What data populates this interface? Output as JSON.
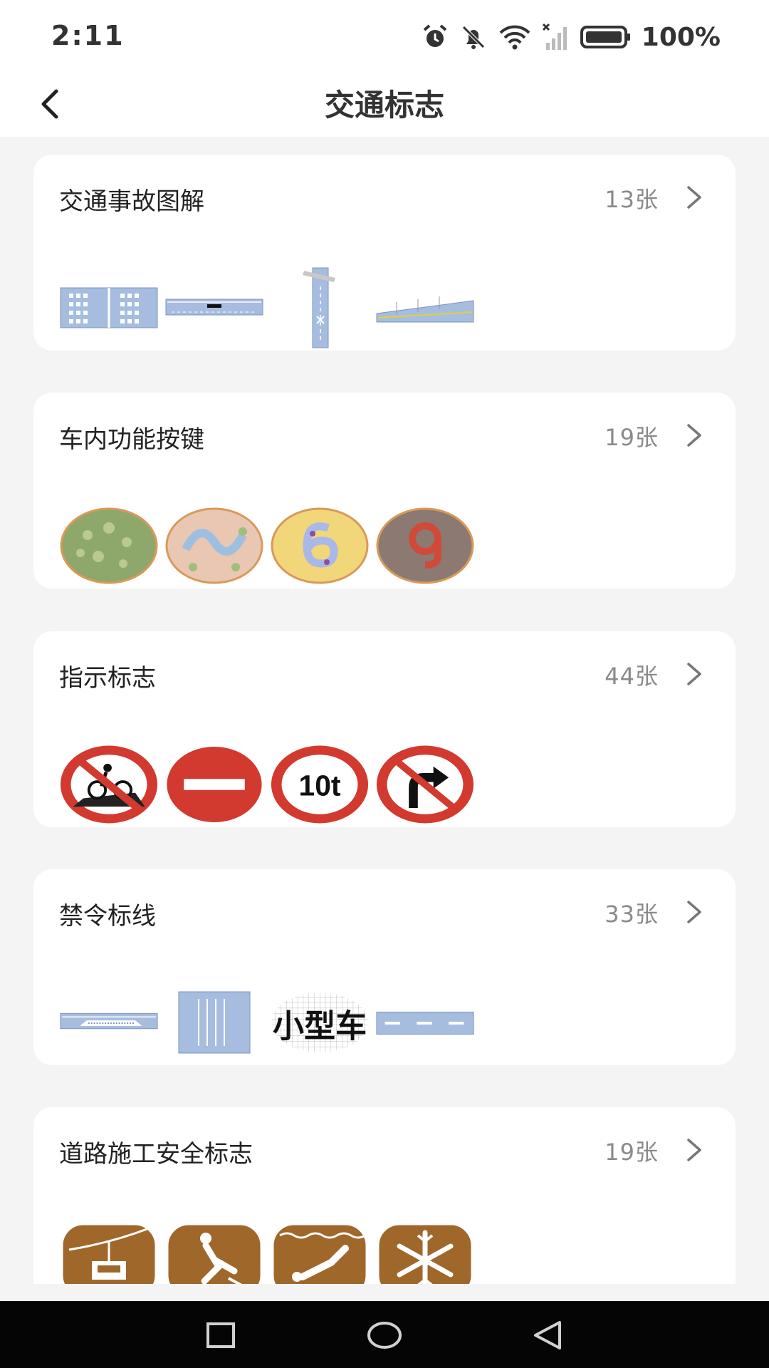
{
  "status_bar": {
    "time": "2:11",
    "battery": "100%",
    "icons": [
      "alarm-icon",
      "bell-off-icon",
      "wifi-icon",
      "no-signal-icon",
      "battery-icon"
    ]
  },
  "header": {
    "title": "交通标志",
    "back_icon": "chevron-left-icon"
  },
  "categories": [
    {
      "title": "交通事故图解",
      "count": "13张",
      "thumbs": [
        "road-diagram-parking",
        "road-diagram-lane",
        "road-diagram-vertical",
        "road-diagram-slope"
      ]
    },
    {
      "title": "车内功能按键",
      "count": "19张",
      "thumbs": [
        "color-plate-green",
        "color-plate-blue",
        "color-plate-six",
        "color-plate-nine"
      ]
    },
    {
      "title": "指示标志",
      "count": "44张",
      "thumbs": [
        "no-bicycle-sign",
        "no-entry-sign",
        "weight-limit-10t-sign",
        "no-right-turn-sign"
      ]
    },
    {
      "title": "禁令标线",
      "count": "33张",
      "thumbs": [
        "road-marking-bus-stop",
        "road-marking-box",
        "small-car-text-marking",
        "road-marking-dashed"
      ]
    },
    {
      "title": "道路施工安全标志",
      "count": "19张",
      "thumbs": [
        "cable-car-sign",
        "ice-skating-sign",
        "diving-sign",
        "snowflake-sign"
      ]
    }
  ],
  "thumb_texts": {
    "weight_limit": "10t",
    "small_car": "小型车"
  },
  "colors": {
    "prohibit_red": "#d23a2f",
    "tourist_brown": "#a0672b",
    "diagram_blue": "#a7bde0"
  },
  "nav_bar": {
    "icons": [
      "recent-apps-icon",
      "home-icon",
      "back-triangle-icon"
    ]
  }
}
